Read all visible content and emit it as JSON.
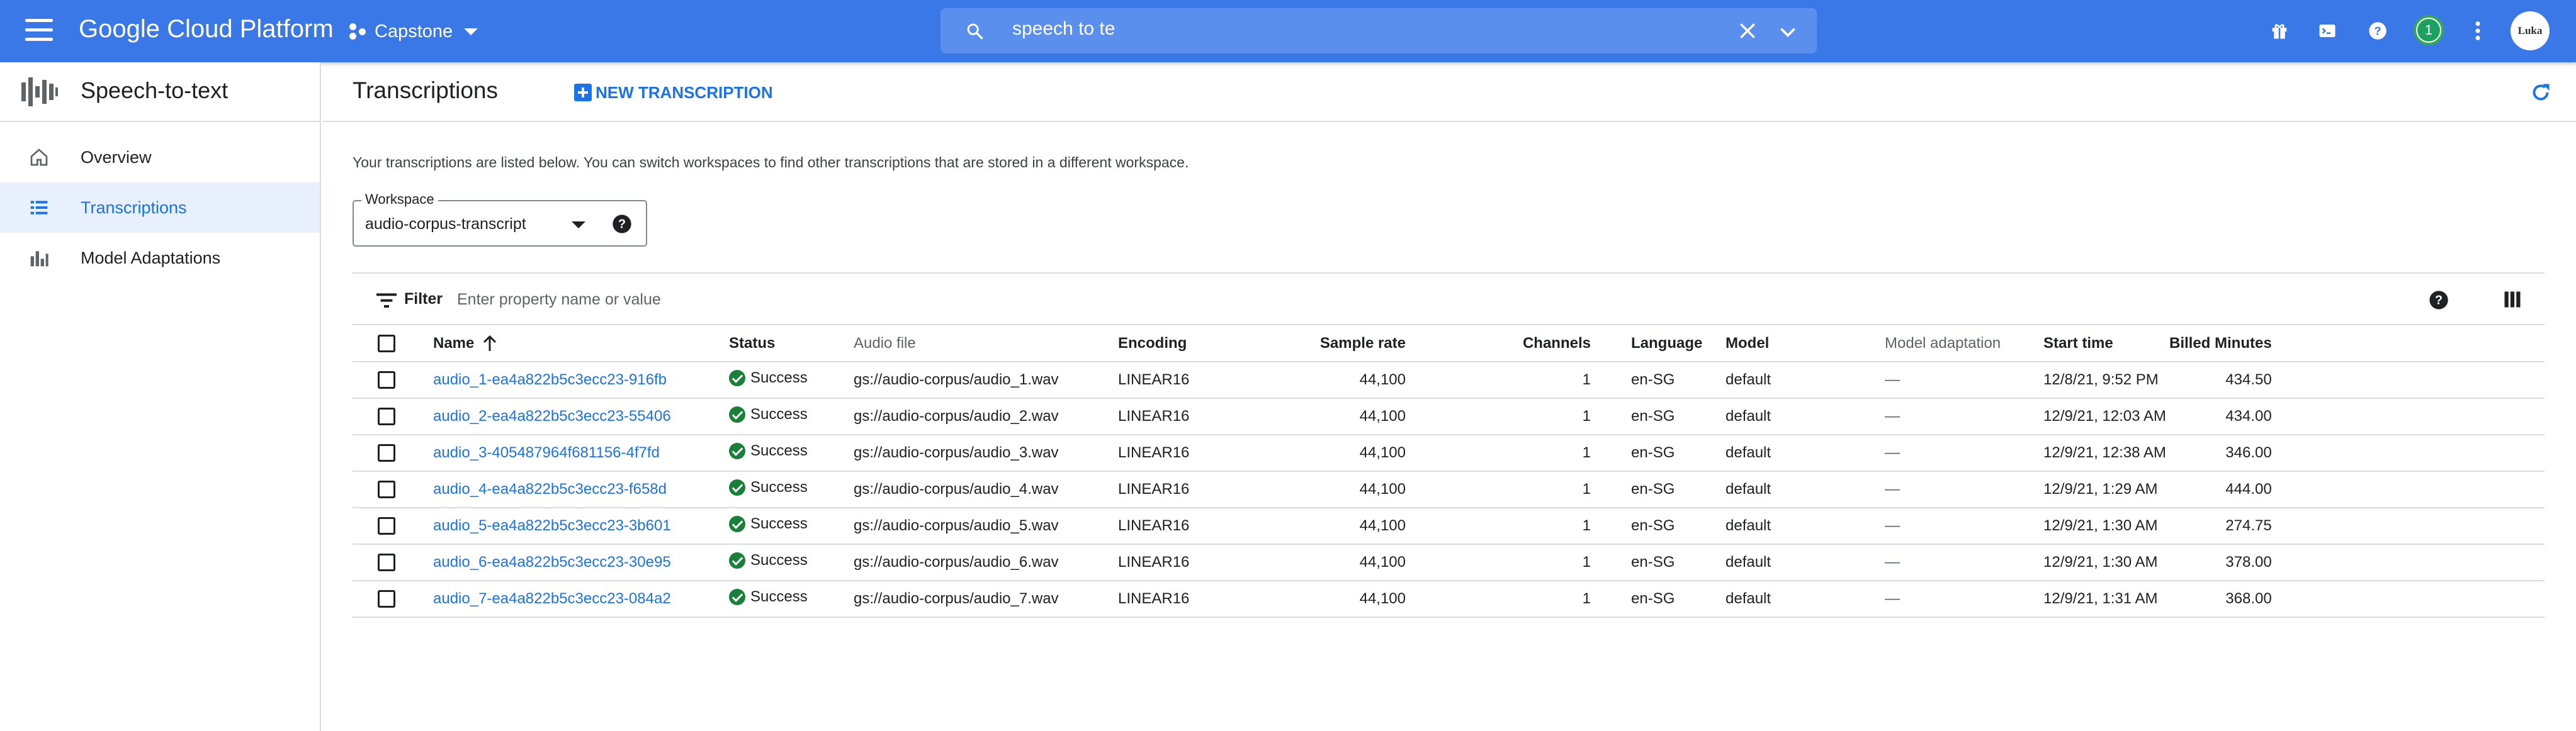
{
  "topbar": {
    "brand": "Google Cloud Platform",
    "project": "Capstone",
    "search_value": "speech to te",
    "notification_count": "1",
    "avatar_label": "Luka",
    "colors": {
      "bar": "#3b78e7",
      "search_bg": "#5a8fee"
    }
  },
  "sidebar": {
    "product_title": "Speech-to-text",
    "items": [
      {
        "label": "Overview",
        "icon": "home-icon",
        "active": false
      },
      {
        "label": "Transcriptions",
        "icon": "list-icon",
        "active": true
      },
      {
        "label": "Model Adaptations",
        "icon": "bar-chart-icon",
        "active": false
      }
    ]
  },
  "main": {
    "title": "Transcriptions",
    "new_button": "NEW TRANSCRIPTION",
    "description": "Your transcriptions are listed below. You can switch workspaces to find other transcriptions that are stored in a different workspace.",
    "workspace": {
      "label": "Workspace",
      "value": "audio-corpus-transcript"
    },
    "filter": {
      "label": "Filter",
      "placeholder": "Enter property name or value"
    },
    "table": {
      "columns": [
        "Name",
        "Status",
        "Audio file",
        "Encoding",
        "Sample rate",
        "Channels",
        "Language",
        "Model",
        "Model adaptation",
        "Start time",
        "Billed Minutes"
      ],
      "rows": [
        [
          "audio_1-ea4a822b5c3ecc23-916fb",
          "Success",
          "gs://audio-corpus/audio_1.wav",
          "LINEAR16",
          "44,100",
          "1",
          "en-SG",
          "default",
          "—",
          "12/8/21, 9:52 PM",
          "434.50"
        ],
        [
          "audio_2-ea4a822b5c3ecc23-55406",
          "Success",
          "gs://audio-corpus/audio_2.wav",
          "LINEAR16",
          "44,100",
          "1",
          "en-SG",
          "default",
          "—",
          "12/9/21, 12:03 AM",
          "434.00"
        ],
        [
          "audio_3-405487964f681156-4f7fd",
          "Success",
          "gs://audio-corpus/audio_3.wav",
          "LINEAR16",
          "44,100",
          "1",
          "en-SG",
          "default",
          "—",
          "12/9/21, 12:38 AM",
          "346.00"
        ],
        [
          "audio_4-ea4a822b5c3ecc23-f658d",
          "Success",
          "gs://audio-corpus/audio_4.wav",
          "LINEAR16",
          "44,100",
          "1",
          "en-SG",
          "default",
          "—",
          "12/9/21, 1:29 AM",
          "444.00"
        ],
        [
          "audio_5-ea4a822b5c3ecc23-3b601",
          "Success",
          "gs://audio-corpus/audio_5.wav",
          "LINEAR16",
          "44,100",
          "1",
          "en-SG",
          "default",
          "—",
          "12/9/21, 1:30 AM",
          "274.75"
        ],
        [
          "audio_6-ea4a822b5c3ecc23-30e95",
          "Success",
          "gs://audio-corpus/audio_6.wav",
          "LINEAR16",
          "44,100",
          "1",
          "en-SG",
          "default",
          "—",
          "12/9/21, 1:30 AM",
          "378.00"
        ],
        [
          "audio_7-ea4a822b5c3ecc23-084a2",
          "Success",
          "gs://audio-corpus/audio_7.wav",
          "LINEAR16",
          "44,100",
          "1",
          "en-SG",
          "default",
          "—",
          "12/9/21, 1:31 AM",
          "368.00"
        ]
      ]
    }
  }
}
